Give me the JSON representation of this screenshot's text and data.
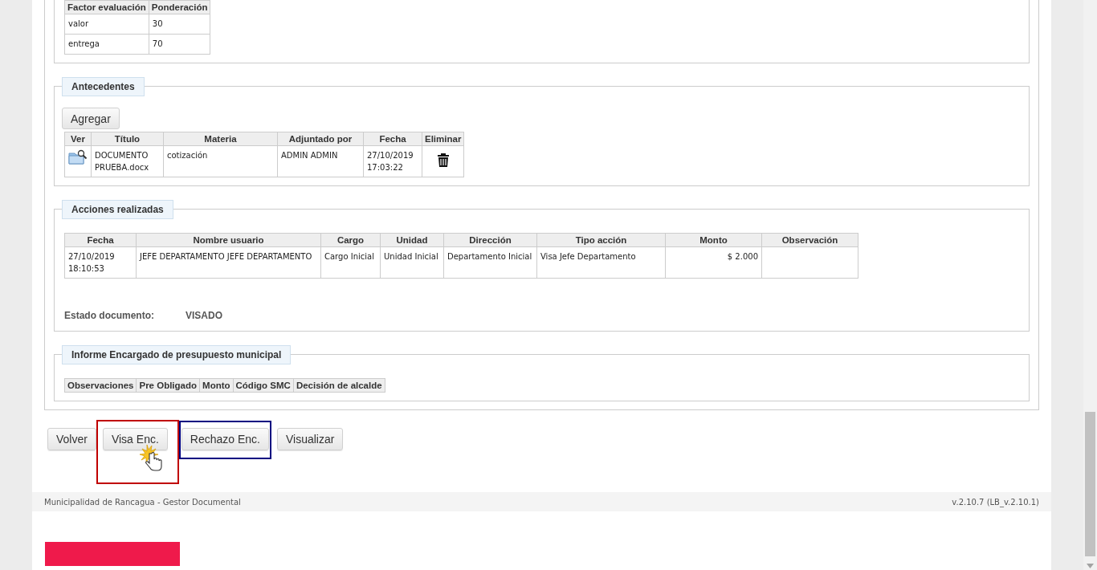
{
  "evaluation_table": {
    "columns": [
      "Factor evaluación",
      "Ponderación"
    ],
    "rows": [
      [
        "valor",
        "30"
      ],
      [
        "entrega",
        "70"
      ]
    ]
  },
  "antecedentes": {
    "legend": "Antecedentes",
    "add_button": "Agregar",
    "columns": [
      "Ver",
      "Título",
      "Materia",
      "Adjuntado por",
      "Fecha",
      "Eliminar"
    ],
    "rows": [
      {
        "titulo": "DOCUMENTO PRUEBA.docx",
        "materia": "cotización",
        "adjuntado_por": "ADMIN ADMIN",
        "fecha": "27/10/2019 17:03:22"
      }
    ]
  },
  "acciones": {
    "legend": "Acciones realizadas",
    "columns": [
      "Fecha",
      "Nombre usuario",
      "Cargo",
      "Unidad",
      "Dirección",
      "Tipo acción",
      "Monto",
      "Observación"
    ],
    "rows": [
      [
        "27/10/2019 18:10:53",
        "JEFE DEPARTAMENTO JEFE DEPARTAMENTO",
        "Cargo Inicial",
        "Unidad Inicial",
        "Departamento Inicial",
        "Visa Jefe Departamento",
        "$ 2.000",
        ""
      ]
    ],
    "estado_label": "Estado documento:",
    "estado_value": "VISADO"
  },
  "informe": {
    "legend": "Informe Encargado de presupuesto municipal",
    "columns": [
      "Observaciones",
      "Pre Obligado",
      "Monto",
      "Código SMC",
      "Decisión de alcalde"
    ]
  },
  "buttons": [
    {
      "label": "Volver",
      "pointer": false
    },
    {
      "label": "Visa Enc.",
      "color": "#c00000",
      "pointer": true
    },
    {
      "label": "Rechazo Enc.",
      "color": "#000080",
      "pointer": false
    },
    {
      "label": "Visualizar",
      "pointer": false
    }
  ],
  "footer": {
    "left": "Municipalidad de Rancagua - Gestor Documental",
    "right": "v.2.10.7 (LB_v.2.10.1)"
  }
}
